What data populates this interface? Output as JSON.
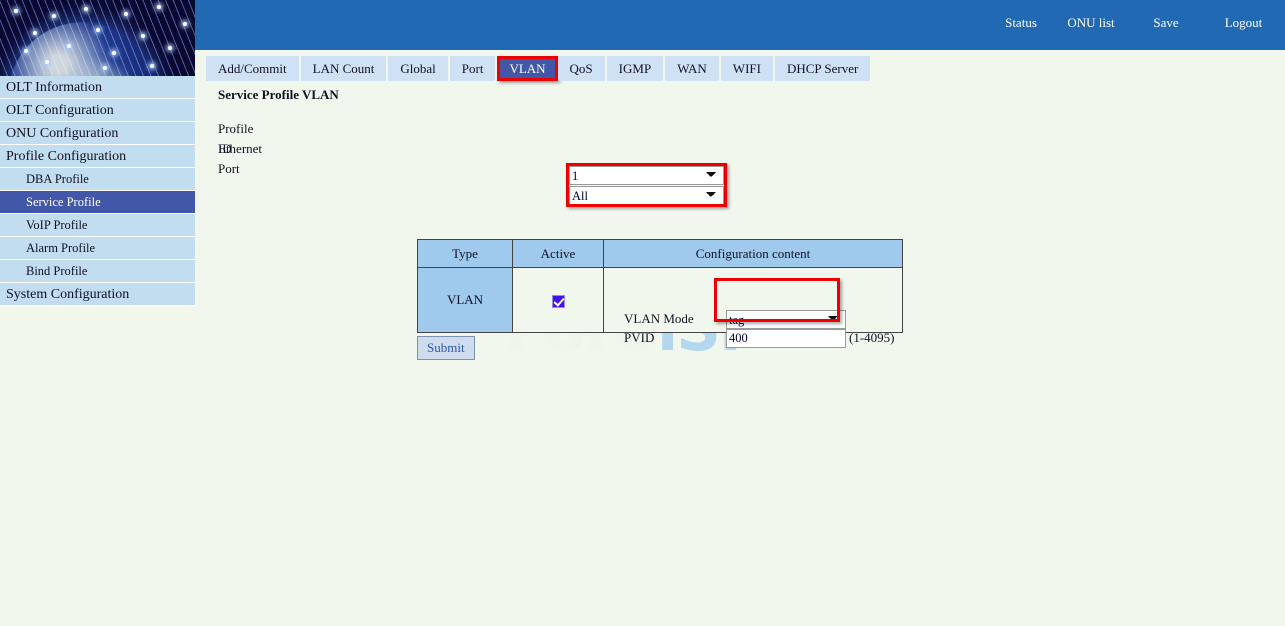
{
  "header": {
    "nav": [
      {
        "label": "Status",
        "name": "status"
      },
      {
        "label": "ONU list",
        "name": "onu-list"
      },
      {
        "label": "Save",
        "name": "save"
      },
      {
        "label": "Logout",
        "name": "logout"
      }
    ],
    "bar_color": "#2269b3"
  },
  "banner": {
    "alt": "fiber-optic-globe-banner"
  },
  "sidebar": {
    "items": [
      {
        "label": "OLT Information",
        "sub": false,
        "active": false
      },
      {
        "label": "OLT Configuration",
        "sub": false,
        "active": false
      },
      {
        "label": "ONU Configuration",
        "sub": false,
        "active": false
      },
      {
        "label": "Profile Configuration",
        "sub": false,
        "active": false
      },
      {
        "label": "DBA Profile",
        "sub": true,
        "active": false
      },
      {
        "label": "Service Profile",
        "sub": true,
        "active": true
      },
      {
        "label": "VoIP Profile",
        "sub": true,
        "active": false
      },
      {
        "label": "Alarm Profile",
        "sub": true,
        "active": false
      },
      {
        "label": "Bind Profile",
        "sub": true,
        "active": false
      },
      {
        "label": "System Configuration",
        "sub": false,
        "active": false
      }
    ],
    "active_color": "#4257a8",
    "item_color": "#c2dcf0"
  },
  "tabs": {
    "items": [
      {
        "label": "Add/Commit",
        "active": false
      },
      {
        "label": "LAN Count",
        "active": false
      },
      {
        "label": "Global",
        "active": false
      },
      {
        "label": "Port",
        "active": false
      },
      {
        "label": "VLAN",
        "active": true
      },
      {
        "label": "QoS",
        "active": false
      },
      {
        "label": "IGMP",
        "active": false
      },
      {
        "label": "WAN",
        "active": false
      },
      {
        "label": "WIFI",
        "active": false
      },
      {
        "label": "DHCP Server",
        "active": false
      }
    ],
    "active_color": "#4257a8",
    "inactive_color": "#cfe2f5",
    "highlight_color": "#ee0000"
  },
  "main": {
    "section_title": "Service Profile VLAN",
    "form": {
      "profile_id": {
        "label": "Profile ID",
        "value": "1"
      },
      "ethernet_port": {
        "label": "Ethernet Port",
        "value": "All"
      }
    },
    "table": {
      "headers": {
        "type": "Type",
        "active": "Active",
        "config": "Configuration content"
      },
      "row": {
        "type": "VLAN",
        "active_checked": true,
        "vlan_mode_label": "VLAN Mode",
        "vlan_mode_value": "tag",
        "pvid_label": "PVID",
        "pvid_value": "400",
        "pvid_hint": "(1-4095)"
      }
    },
    "submit_label": "Submit"
  },
  "watermark": {
    "text_left": "Foro",
    "text_right": "iSP"
  }
}
